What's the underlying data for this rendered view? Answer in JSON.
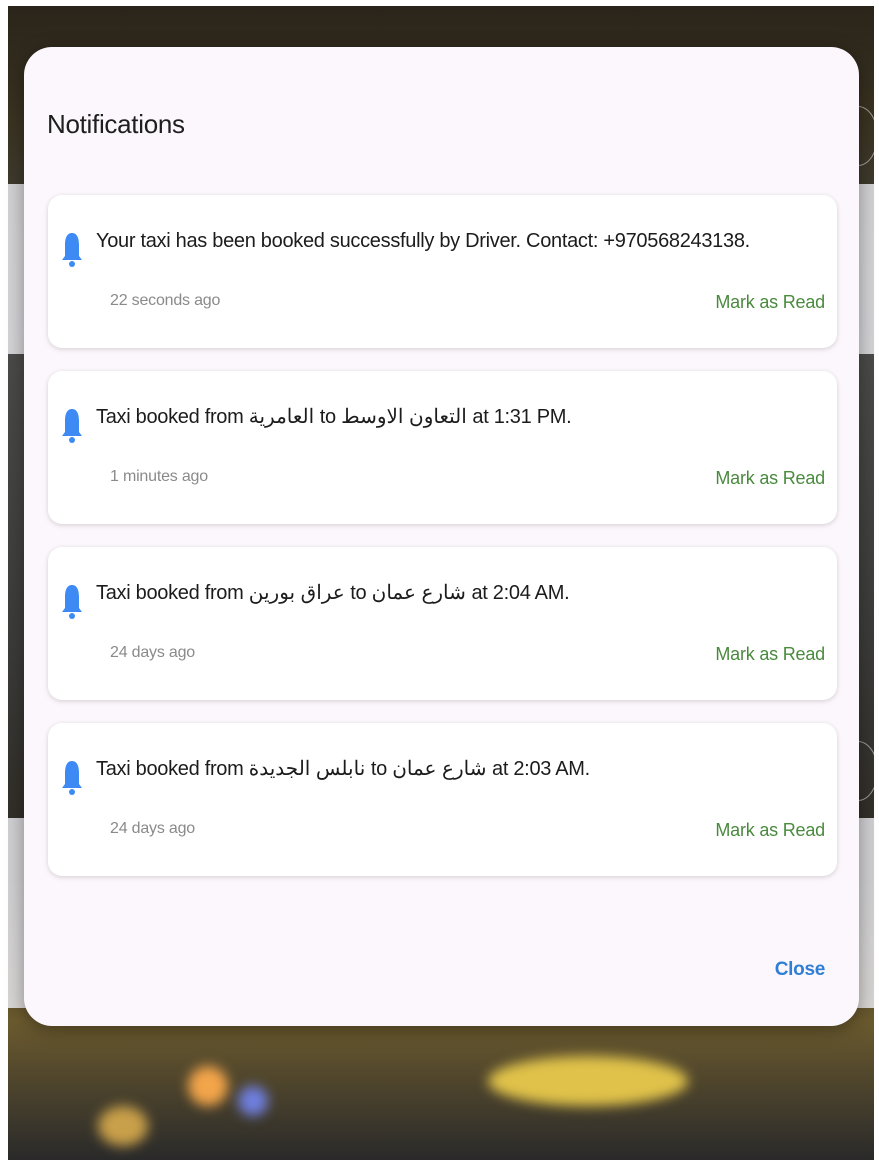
{
  "dialog": {
    "title": "Notifications",
    "close_label": "Close"
  },
  "notifications": [
    {
      "message": "Your taxi has been booked successfully by Driver. Contact: +970568243138.",
      "time": "22 seconds ago",
      "action": "Mark as Read"
    },
    {
      "message": "Taxi booked from العامرية to التعاون الاوسط at 1:31 PM.",
      "time": "1 minutes ago",
      "action": "Mark as Read"
    },
    {
      "message": "Taxi booked from عراق بورين to  شارع عمان at 2:04 AM.",
      "time": "24 days ago",
      "action": "Mark as Read"
    },
    {
      "message": "Taxi booked from نابلس الجديدة to  شارع عمان at 2:03 AM.",
      "time": "24 days ago",
      "action": "Mark as Read"
    }
  ],
  "icons": {
    "notification": "bell-icon"
  },
  "colors": {
    "dialog_bg": "#fcf7fc",
    "bell": "#3d8af5",
    "mark_as_read": "#4a8a3e",
    "close": "#2f7fd6"
  }
}
